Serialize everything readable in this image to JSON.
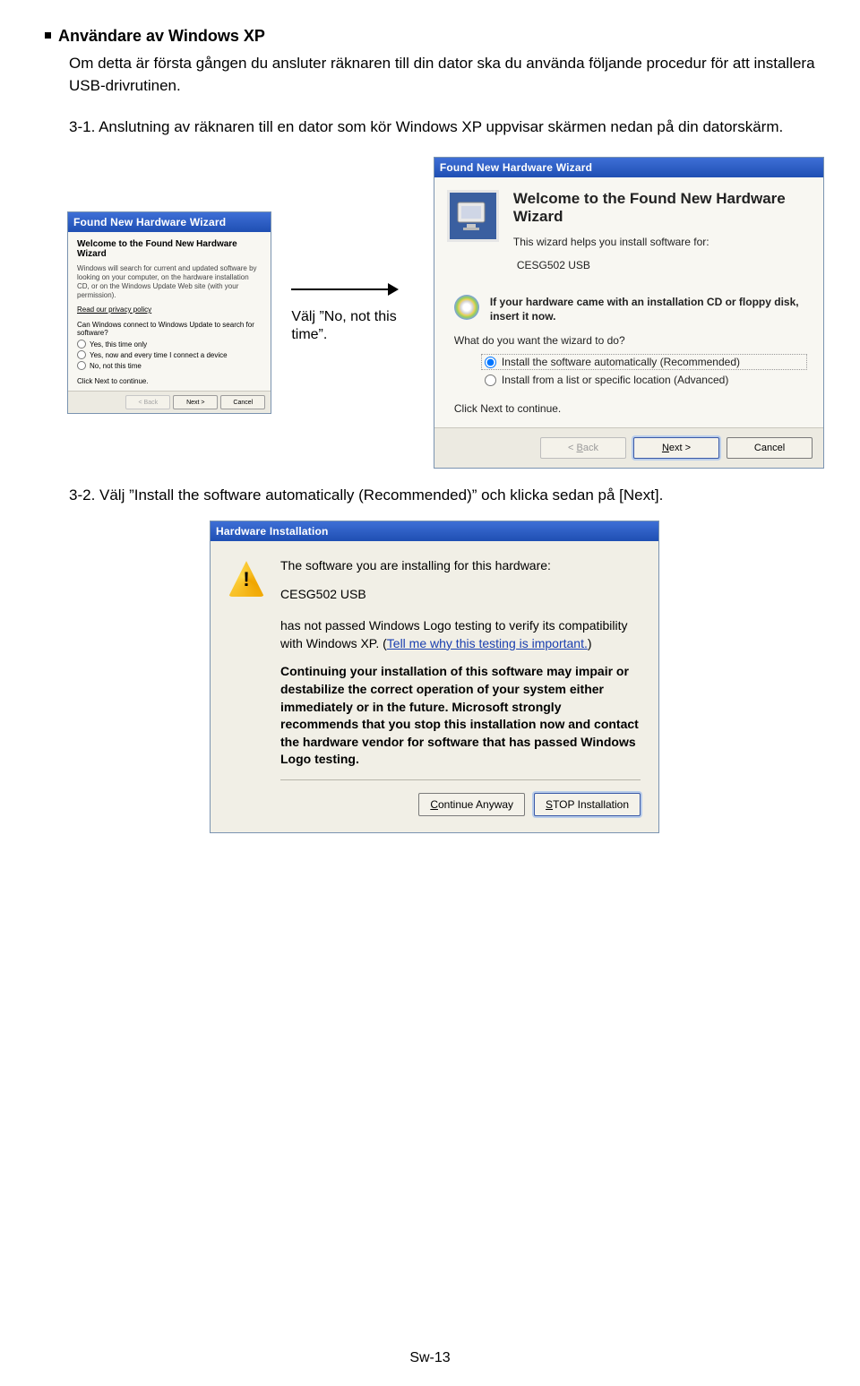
{
  "heading": "Användare av Windows XP",
  "intro": "Om detta är första gången du ansluter räknaren till din dator ska du använda följande procedur för att installera USB-drivrutinen.",
  "step31": "3-1. Anslutning av räknaren till en dator som kör Windows XP uppvisar skärmen nedan på din datorskärm.",
  "step32": "3-2. Välj ”Install the software automatically (Recommended)” och klicka sedan på [Next].",
  "arrow_label": "Välj ”No, not this time”.",
  "small": {
    "titlebar": "Found New Hardware Wizard",
    "title": "Welcome to the Found New Hardware Wizard",
    "p": "Windows will search for current and updated software by looking on your computer, on the hardware installation CD, or on the Windows Update Web site (with your permission).",
    "privacy": "Read our privacy policy",
    "q": "Can Windows connect to Windows Update to search for software?",
    "o1": "Yes, this time only",
    "o2": "Yes, now and every time I connect a device",
    "o3": "No, not this time",
    "cont": "Click Next to continue.",
    "back": "< Back",
    "next": "Next >",
    "cancel": "Cancel"
  },
  "big": {
    "titlebar": "Found New Hardware Wizard",
    "title": "Welcome to the Found New Hardware Wizard",
    "sub": "This wizard helps you install software for:",
    "device": "CESG502 USB",
    "cd": "If your hardware came with an installation CD or floppy disk, insert it now.",
    "q": "What do you want the wizard to do?",
    "o1": "Install the software automatically (Recommended)",
    "o2": "Install from a list or specific location (Advanced)",
    "cont": "Click Next to continue.",
    "back": "< Back",
    "next": "Next >",
    "cancel": "Cancel"
  },
  "warn": {
    "titlebar": "Hardware Installation",
    "p1": "The software you are installing for this hardware:",
    "device": "CESG502 USB",
    "p2a": "has not passed Windows Logo testing to verify its compatibility with Windows XP. (",
    "link": "Tell me why this testing is important.",
    "p2b": ")",
    "p3": "Continuing your installation of this software may impair or destabilize the correct operation of your system either immediately or in the future. Microsoft strongly recommends that you stop this installation now and contact the hardware vendor for software that has passed Windows Logo testing.",
    "btn_continue": "Continue Anyway",
    "btn_stop": "STOP Installation"
  },
  "footer": "Sw-13"
}
